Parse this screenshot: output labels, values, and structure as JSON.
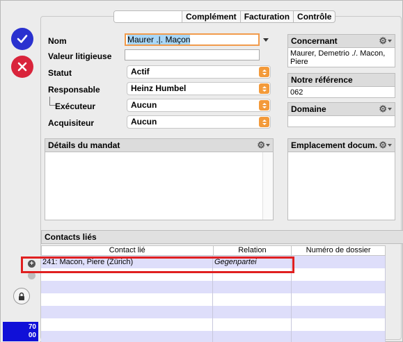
{
  "tabs": [
    {
      "label": ""
    },
    {
      "label": "Complément"
    },
    {
      "label": "Facturation"
    },
    {
      "label": "Contrôle"
    }
  ],
  "form": {
    "nom_label": "Nom",
    "nom_value": "Maurer .|. Maçon",
    "valeur_label": "Valeur litigieuse",
    "valeur_value": "",
    "statut_label": "Statut",
    "statut_value": "Actif",
    "responsable_label": "Responsable",
    "responsable_value": "Heinz Humbel",
    "executeur_label": "Exécuteur",
    "executeur_value": "Aucun",
    "acquisiteur_label": "Acquisiteur",
    "acquisiteur_value": "Aucun"
  },
  "concernant": {
    "header": "Concernant",
    "text": "Maurer, Demetrio ./. Macon, Piere"
  },
  "reference": {
    "header": "Notre référence",
    "value": "062"
  },
  "domaine": {
    "header": "Domaine",
    "value": ""
  },
  "details": {
    "header": "Détails du mandat"
  },
  "emplacement": {
    "header": "Emplacement docum."
  },
  "contacts": {
    "header": "Contacts liés",
    "columns": [
      "Contact lié",
      "Relation",
      "Numéro de dossier"
    ],
    "rows": [
      {
        "contact": "241: Macon, Piere (Zürich)",
        "relation": "Gegenpartei",
        "dossier": ""
      }
    ]
  },
  "counter": {
    "line1": "70",
    "line2": "00"
  },
  "colors": {
    "ok": "#2a31cf",
    "cancel": "#d9243b",
    "stepper": "#f39a3a",
    "highlight": "#e02020",
    "row_stripe": "#dedefa"
  }
}
